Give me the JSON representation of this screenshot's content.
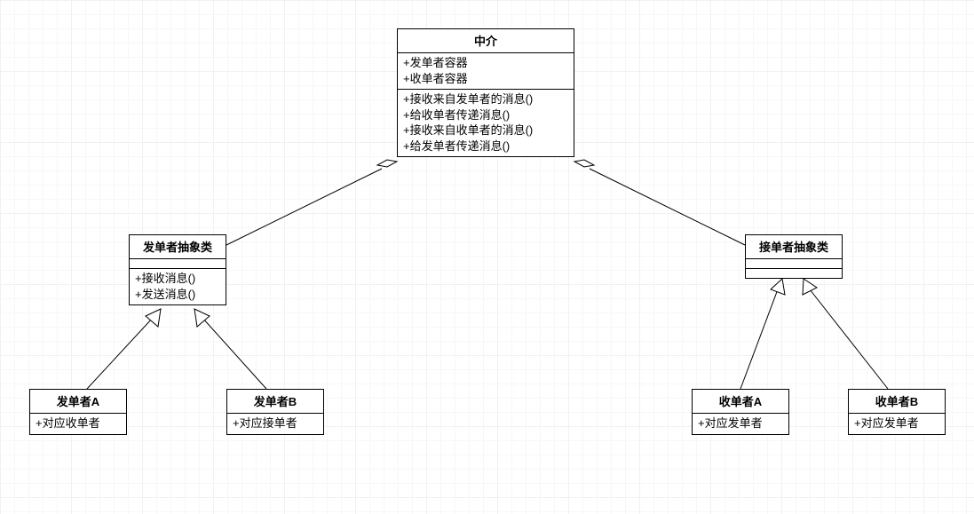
{
  "classes": {
    "mediator": {
      "title": "中介",
      "attrs": [
        "+发单者容器",
        "+收单者容器"
      ],
      "ops": [
        "+接收来自发单者的消息()",
        "+给收单者传递消息()",
        "+接收来自收单者的消息()",
        "+给发单者传递消息()"
      ]
    },
    "senderAbs": {
      "title": "发单者抽象类",
      "attrs": [],
      "ops": [
        "+接收消息()",
        "+发送消息()"
      ]
    },
    "receiverAbs": {
      "title": "接单者抽象类",
      "attrs": [],
      "ops": []
    },
    "senderA": {
      "title": "发单者A",
      "attrs": [
        "+对应收单者"
      ],
      "ops": []
    },
    "senderB": {
      "title": "发单者B",
      "attrs": [
        "+对应接单者"
      ],
      "ops": []
    },
    "receiverA": {
      "title": "收单者A",
      "attrs": [
        "+对应发单者"
      ],
      "ops": []
    },
    "receiverB": {
      "title": "收单者B",
      "attrs": [
        "+对应发单者"
      ],
      "ops": []
    }
  },
  "relations": [
    {
      "type": "aggregation",
      "whole": "mediator",
      "part": "senderAbs"
    },
    {
      "type": "aggregation",
      "whole": "mediator",
      "part": "receiverAbs"
    },
    {
      "type": "generalization",
      "parent": "senderAbs",
      "child": "senderA"
    },
    {
      "type": "generalization",
      "parent": "senderAbs",
      "child": "senderB"
    },
    {
      "type": "generalization",
      "parent": "receiverAbs",
      "child": "receiverA"
    },
    {
      "type": "generalization",
      "parent": "receiverAbs",
      "child": "receiverB"
    }
  ]
}
